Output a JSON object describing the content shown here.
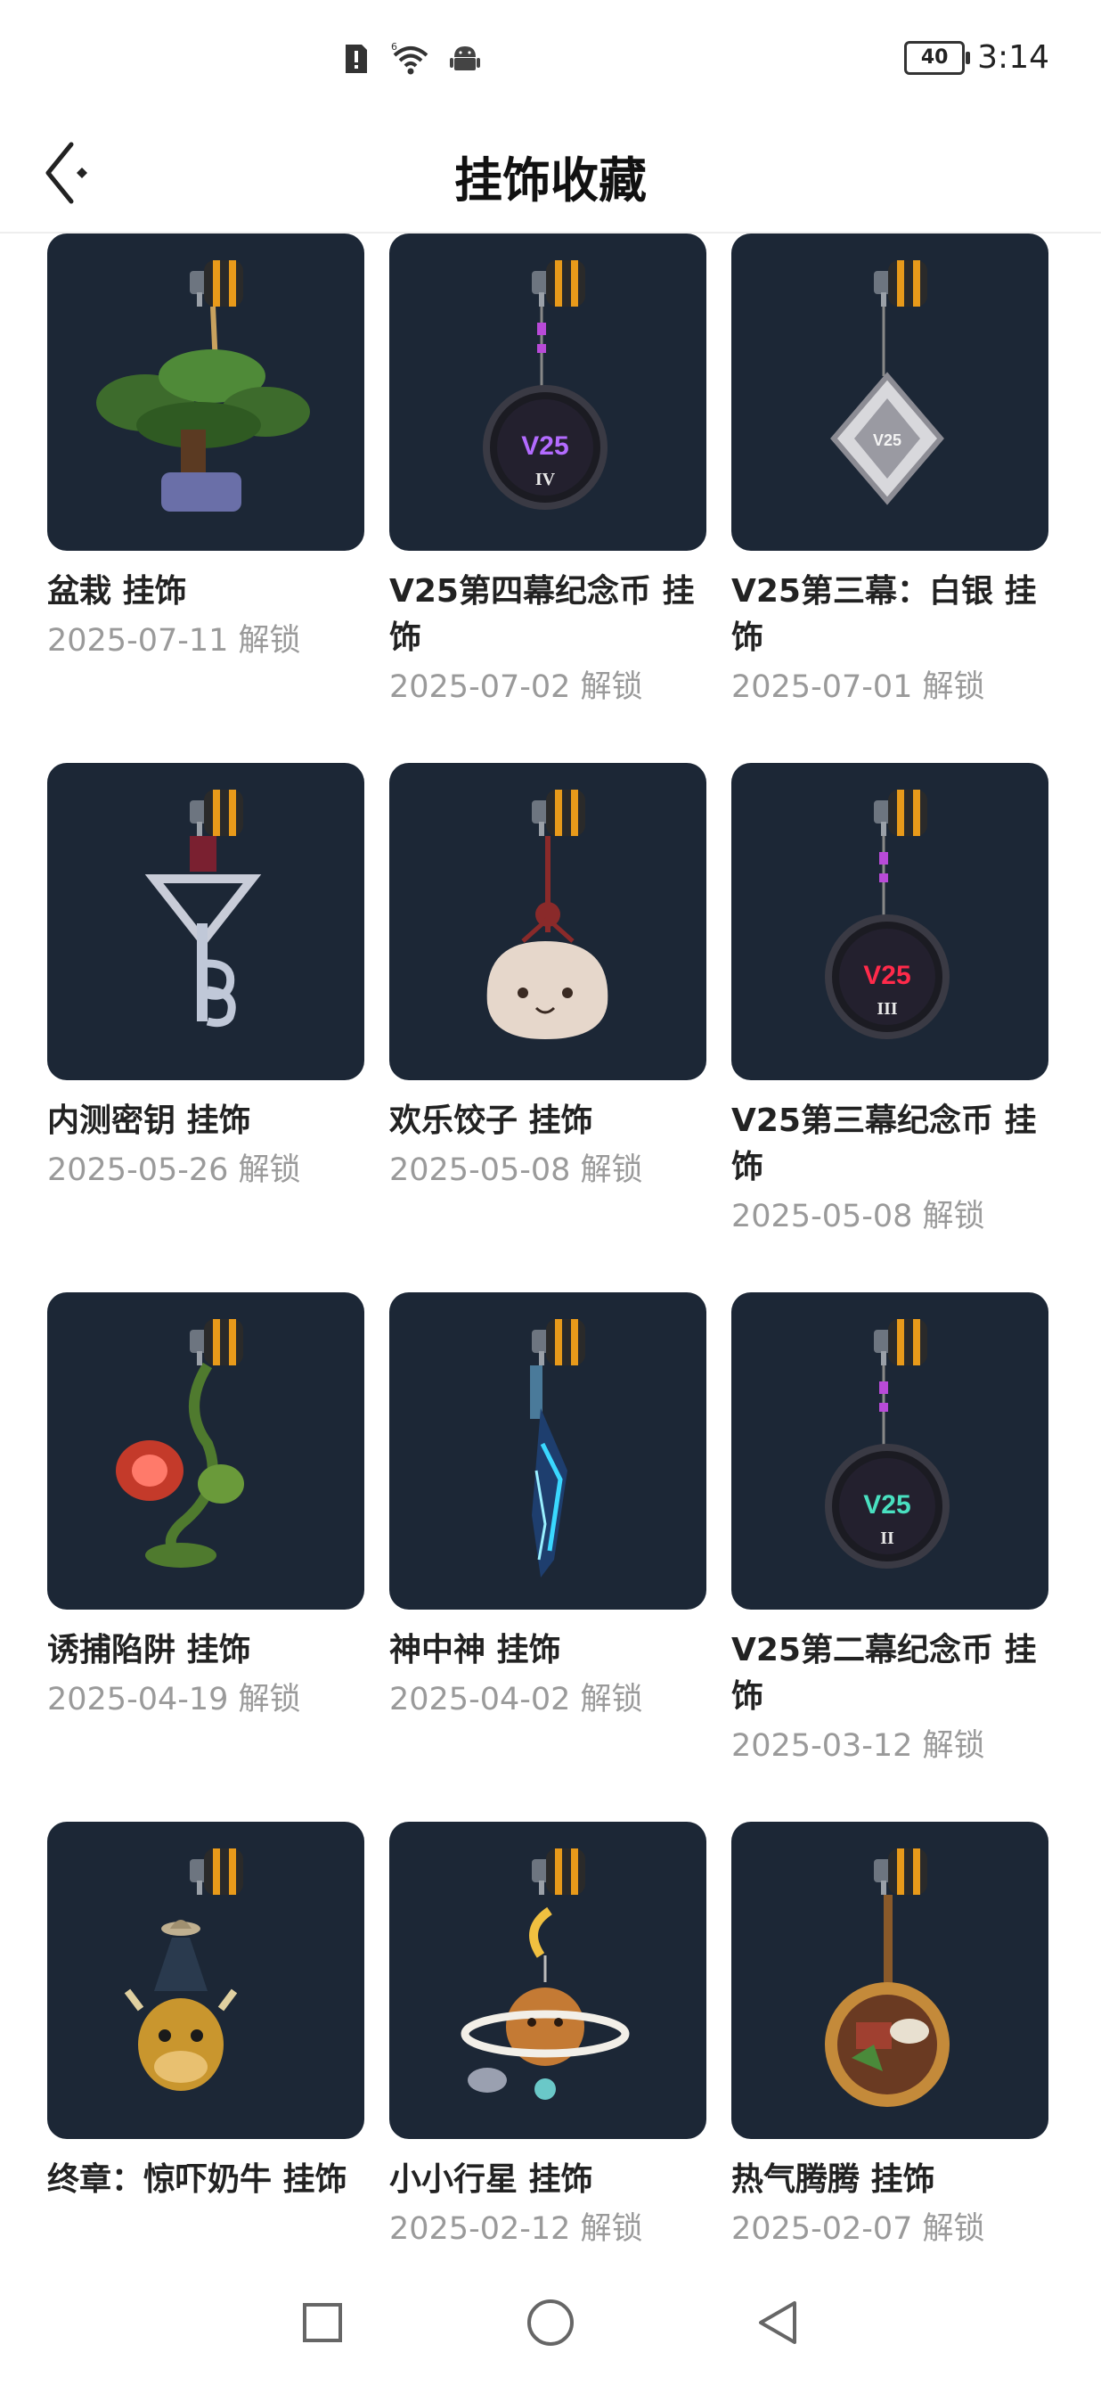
{
  "status_bar": {
    "time": "3:14",
    "battery": "40",
    "notification_badge": "!",
    "wifi_label": "6"
  },
  "header": {
    "title": "挂饰收藏",
    "back_icon": "back-arrow-icon"
  },
  "items": [
    {
      "name": "盆栽 挂饰",
      "date": "2025-07-11 解锁",
      "icon": "bonsai-charm-icon"
    },
    {
      "name": "V25第四幕纪念币 挂饰",
      "date": "2025-07-02 解锁",
      "icon": "v25-iv-coin-charm-icon",
      "badge": "V25",
      "sub": "IV",
      "color": "#b36bff"
    },
    {
      "name": "V25第三幕：白银 挂饰",
      "date": "2025-07-01 解锁",
      "icon": "v25-silver-charm-icon",
      "badge": "V25"
    },
    {
      "name": "内测密钥 挂饰",
      "date": "2025-05-26 解锁",
      "icon": "beta-key-charm-icon"
    },
    {
      "name": "欢乐饺子 挂饰",
      "date": "2025-05-08 解锁",
      "icon": "dumpling-charm-icon"
    },
    {
      "name": "V25第三幕纪念币 挂饰",
      "date": "2025-05-08 解锁",
      "icon": "v25-iii-coin-charm-icon",
      "badge": "V25",
      "sub": "III",
      "color": "#ff2a4a"
    },
    {
      "name": "诱捕陷阱 挂饰",
      "date": "2025-04-19 解锁",
      "icon": "trap-plant-charm-icon"
    },
    {
      "name": "神中神 挂饰",
      "date": "2025-04-02 解锁",
      "icon": "blade-charm-icon"
    },
    {
      "name": "V25第二幕纪念币 挂饰",
      "date": "2025-03-12 解锁",
      "icon": "v25-ii-coin-charm-icon",
      "badge": "V25",
      "sub": "II",
      "color": "#49e0c0"
    },
    {
      "name": "终章：惊吓奶牛 挂饰",
      "date": "",
      "icon": "cow-ufo-charm-icon"
    },
    {
      "name": "小小行星 挂饰",
      "date": "2025-02-12 解锁",
      "icon": "planet-charm-icon"
    },
    {
      "name": "热气腾腾 挂饰",
      "date": "2025-02-07 解锁",
      "icon": "hotpot-charm-icon"
    }
  ],
  "nav": {
    "recents_icon": "square-recents-icon",
    "home_icon": "circle-home-icon",
    "back_icon": "triangle-back-icon"
  },
  "colors": {
    "card_bg": "#1c2736",
    "clip_gold": "#f0a020",
    "date_gray": "#9a9a9a"
  }
}
